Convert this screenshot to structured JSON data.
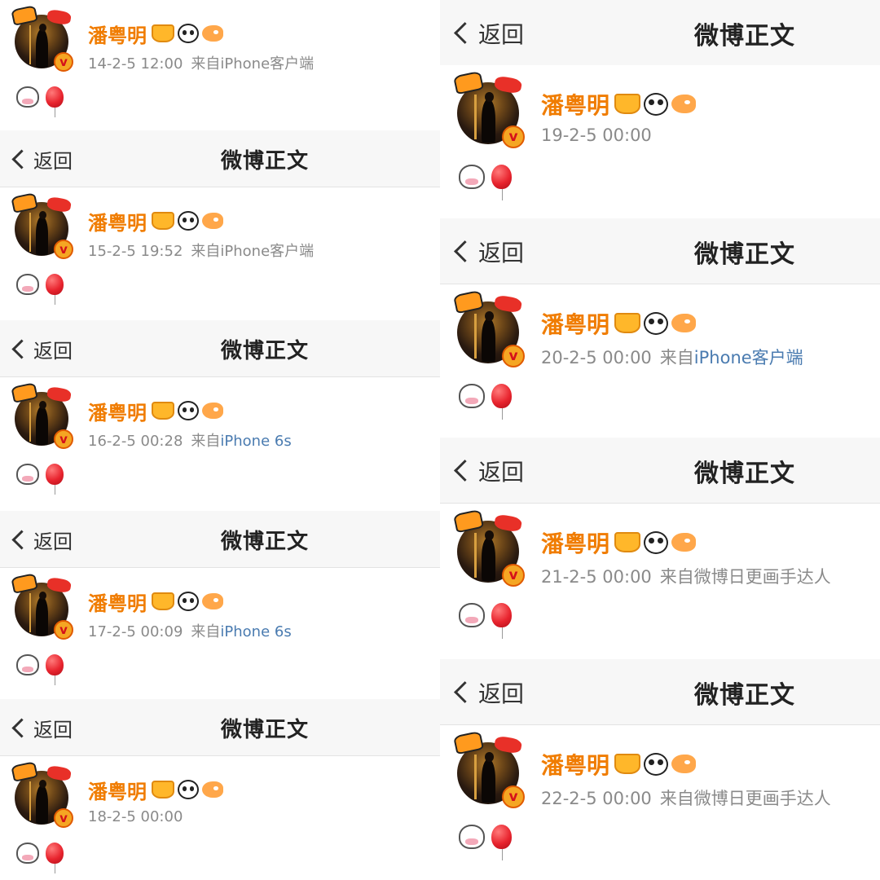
{
  "colors": {
    "name": "#f07c00",
    "meta": "#8a8a8a",
    "link": "#4a7bb0",
    "navbar_bg": "#f7f7f7"
  },
  "icons": {
    "back": "chevron-left-icon",
    "verified": "verified-v-badge-icon",
    "badges": [
      "crown-badge-icon",
      "panda-badge-icon",
      "fish-badge-icon"
    ],
    "emojis": [
      "cow-emoji-icon",
      "balloon-emoji-icon"
    ]
  },
  "verified_mark": "v",
  "screenshots": [
    {
      "nav": null,
      "post": {
        "user_name": "潘粤明",
        "time": "14-2-5 12:00",
        "source_prefix": "来自",
        "source_text": "iPhone客户端",
        "source_is_link": false
      }
    },
    {
      "nav": {
        "back_label": "返回",
        "title": "微博正文"
      },
      "post": {
        "user_name": "潘粤明",
        "time": "15-2-5 19:52",
        "source_prefix": "来自",
        "source_text": "iPhone客户端",
        "source_is_link": false
      }
    },
    {
      "nav": {
        "back_label": "返回",
        "title": "微博正文"
      },
      "post": {
        "user_name": "潘粤明",
        "time": "16-2-5 00:28",
        "source_prefix": "来自",
        "source_text": "iPhone 6s",
        "source_is_link": true
      }
    },
    {
      "nav": {
        "back_label": "返回",
        "title": "微博正文"
      },
      "post": {
        "user_name": "潘粤明",
        "time": "17-2-5 00:09",
        "source_prefix": "来自",
        "source_text": "iPhone 6s",
        "source_is_link": true
      }
    },
    {
      "nav": {
        "back_label": "返回",
        "title": "微博正文"
      },
      "post": {
        "user_name": "潘粤明",
        "time": "18-2-5 00:00",
        "source_prefix": "",
        "source_text": "",
        "source_is_link": false
      }
    },
    {
      "nav": {
        "back_label": "返回",
        "title": "微博正文"
      },
      "post": {
        "user_name": "潘粤明",
        "time": "19-2-5 00:00",
        "source_prefix": "",
        "source_text": "",
        "source_is_link": false
      }
    },
    {
      "nav": {
        "back_label": "返回",
        "title": "微博正文"
      },
      "post": {
        "user_name": "潘粤明",
        "time": "20-2-5 00:00",
        "source_prefix": "来自",
        "source_text": "iPhone客户端",
        "source_is_link": true
      }
    },
    {
      "nav": {
        "back_label": "返回",
        "title": "微博正文"
      },
      "post": {
        "user_name": "潘粤明",
        "time": "21-2-5 00:00",
        "source_prefix": "来自",
        "source_text": "微博日更画手达人",
        "source_is_link": false
      }
    },
    {
      "nav": {
        "back_label": "返回",
        "title": "微博正文"
      },
      "post": {
        "user_name": "潘粤明",
        "time": "22-2-5 00:00",
        "source_prefix": "来自",
        "source_text": "微博日更画手达人",
        "source_is_link": false
      }
    }
  ]
}
